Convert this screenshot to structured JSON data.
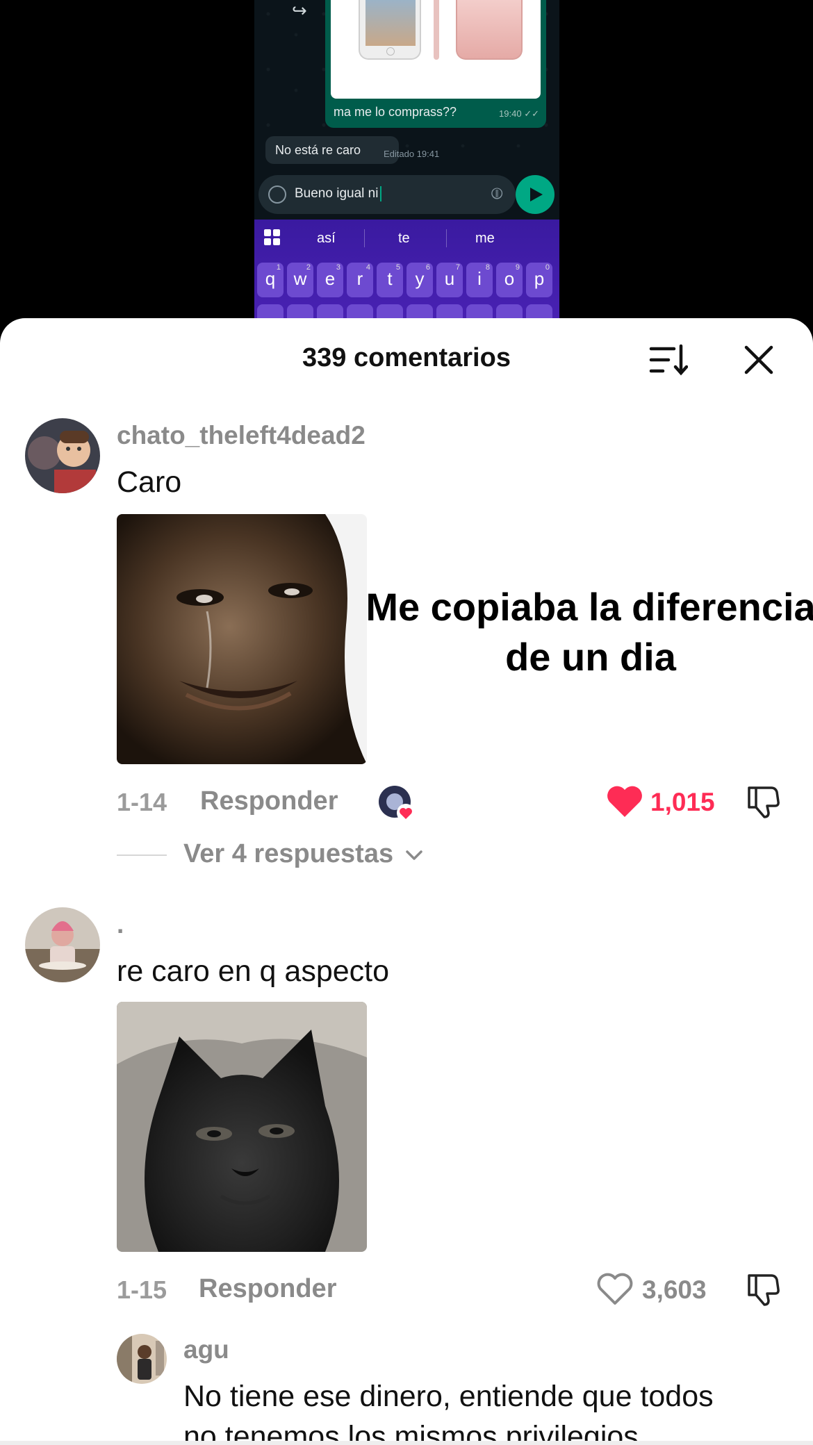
{
  "video": {
    "sent_message": "ma me lo comprass??",
    "sent_time": "19:40",
    "received_message": "No está re caro",
    "received_status": "Editado 19:41",
    "compose_text": "Bueno igual ni",
    "keyboard": {
      "suggestions": [
        "así",
        "te",
        "me"
      ],
      "keys": [
        "q",
        "w",
        "e",
        "r",
        "t",
        "y",
        "u",
        "i",
        "o",
        "p"
      ],
      "key_numbers": [
        "1",
        "2",
        "3",
        "4",
        "5",
        "6",
        "7",
        "8",
        "9",
        "0"
      ]
    }
  },
  "sheet": {
    "title": "339 comentarios",
    "sort_icon": "sort-descending-icon",
    "close_icon": "close-icon"
  },
  "comments": [
    {
      "username": "chato_theleft4dead2",
      "text": "Caro",
      "meme_caption_line1": "Me copiaba la diferencia",
      "meme_caption_line2": "de un dia",
      "date": "1-14",
      "reply_label": "Responder",
      "likes": "1,015",
      "liked": true,
      "view_replies": "Ver 4 respuestas"
    },
    {
      "username": ".",
      "text": "re caro en q aspecto",
      "date": "1-15",
      "reply_label": "Responder",
      "likes": "3,603",
      "liked": false
    }
  ],
  "reply": {
    "username": "agu",
    "text_line1": "No tiene ese dinero, entiende que todos",
    "text_line2": "no tenemos los mismos privilegios"
  },
  "colors": {
    "like_red": "#fe2c55",
    "muted_gray": "#8a8a8a",
    "whatsapp_green": "#00a884"
  }
}
